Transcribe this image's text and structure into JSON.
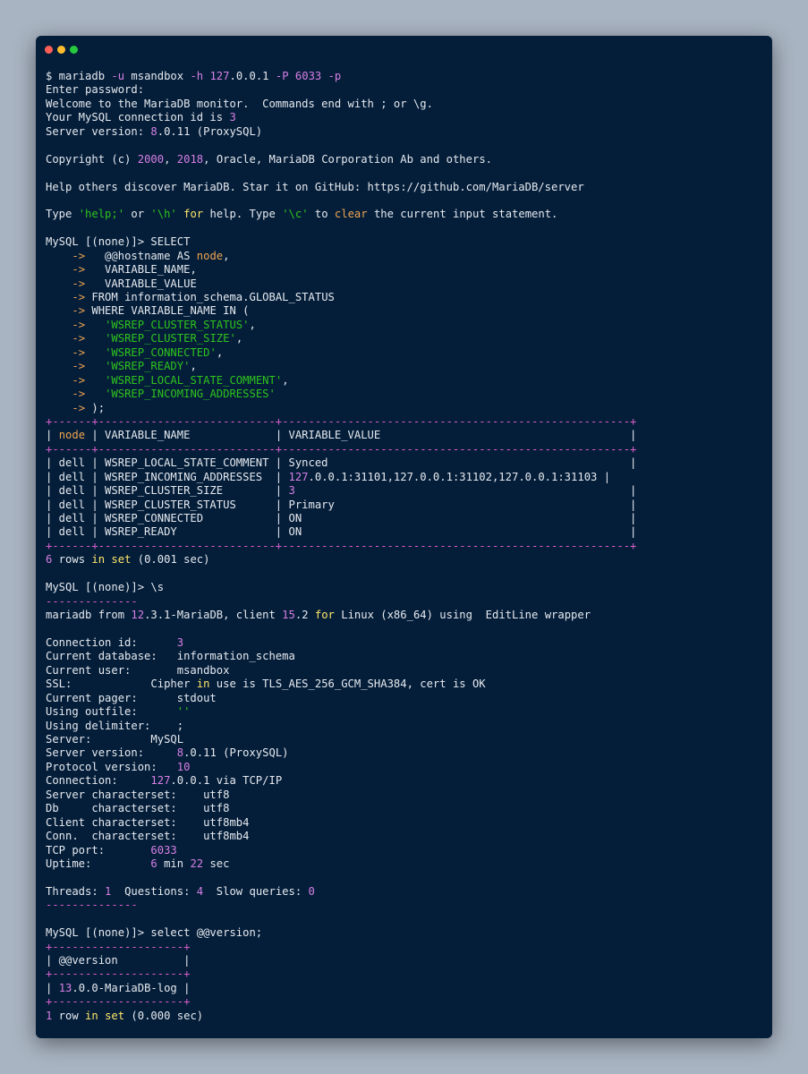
{
  "window": {
    "buttons": [
      "close",
      "minimize",
      "maximize"
    ],
    "colors": {
      "background": "#041e3a",
      "page": "#a9b4c2",
      "magenta": "#d77fe3",
      "green": "#2ec21c",
      "orange": "#f0a450",
      "yellow": "#ffe66a"
    }
  },
  "lines": [
    [
      [
        "$ mariadb ",
        ""
      ],
      [
        "-u",
        "m"
      ],
      [
        " msandbox ",
        ""
      ],
      [
        "-h",
        "m"
      ],
      [
        " ",
        ""
      ],
      [
        "127",
        "m"
      ],
      [
        ".0.0.1 ",
        ""
      ],
      [
        "-P",
        "m"
      ],
      [
        " ",
        ""
      ],
      [
        "6033",
        "m"
      ],
      [
        " ",
        ""
      ],
      [
        "-p",
        "m"
      ]
    ],
    [
      [
        "Enter password:",
        ""
      ]
    ],
    [
      [
        "Welcome to the MariaDB monitor.  Commands end with ; or \\g.",
        ""
      ]
    ],
    [
      [
        "Your MySQL connection id is ",
        ""
      ],
      [
        "3",
        "m"
      ]
    ],
    [
      [
        "Server version: ",
        ""
      ],
      [
        "8",
        "m"
      ],
      [
        ".0.11 (ProxySQL)",
        ""
      ]
    ],
    [],
    [
      [
        "Copyright (c) ",
        ""
      ],
      [
        "2000",
        "m"
      ],
      [
        ", ",
        ""
      ],
      [
        "2018",
        "m"
      ],
      [
        ", Oracle, MariaDB Corporation Ab and others.",
        ""
      ]
    ],
    [],
    [
      [
        "Help others discover MariaDB. Star it on GitHub: https://github.com/MariaDB/server",
        ""
      ]
    ],
    [],
    [
      [
        "Type ",
        ""
      ],
      [
        "'help;'",
        "g"
      ],
      [
        " or ",
        ""
      ],
      [
        "'\\h'",
        "g"
      ],
      [
        " ",
        ""
      ],
      [
        "for",
        "y"
      ],
      [
        " help. Type ",
        ""
      ],
      [
        "'\\c'",
        "g"
      ],
      [
        " to ",
        ""
      ],
      [
        "clear",
        "o"
      ],
      [
        " the current input statement.",
        ""
      ]
    ],
    [],
    [
      [
        "MySQL [(none)]> SELECT",
        ""
      ]
    ],
    [
      [
        "    ",
        ""
      ],
      [
        "->",
        "o"
      ],
      [
        "   @@hostname AS ",
        ""
      ],
      [
        "node",
        "o"
      ],
      [
        ",",
        ""
      ]
    ],
    [
      [
        "    ",
        ""
      ],
      [
        "->",
        "o"
      ],
      [
        "   VARIABLE_NAME,",
        ""
      ]
    ],
    [
      [
        "    ",
        ""
      ],
      [
        "->",
        "o"
      ],
      [
        "   VARIABLE_VALUE",
        ""
      ]
    ],
    [
      [
        "    ",
        ""
      ],
      [
        "->",
        "o"
      ],
      [
        " FROM information_schema.GLOBAL_STATUS",
        ""
      ]
    ],
    [
      [
        "    ",
        ""
      ],
      [
        "->",
        "o"
      ],
      [
        " WHERE VARIABLE_NAME IN (",
        ""
      ]
    ],
    [
      [
        "    ",
        ""
      ],
      [
        "->",
        "o"
      ],
      [
        "   ",
        ""
      ],
      [
        "'WSREP_CLUSTER_STATUS'",
        "g"
      ],
      [
        ",",
        ""
      ]
    ],
    [
      [
        "    ",
        ""
      ],
      [
        "->",
        "o"
      ],
      [
        "   ",
        ""
      ],
      [
        "'WSREP_CLUSTER_SIZE'",
        "g"
      ],
      [
        ",",
        ""
      ]
    ],
    [
      [
        "    ",
        ""
      ],
      [
        "->",
        "o"
      ],
      [
        "   ",
        ""
      ],
      [
        "'WSREP_CONNECTED'",
        "g"
      ],
      [
        ",",
        ""
      ]
    ],
    [
      [
        "    ",
        ""
      ],
      [
        "->",
        "o"
      ],
      [
        "   ",
        ""
      ],
      [
        "'WSREP_READY'",
        "g"
      ],
      [
        ",",
        ""
      ]
    ],
    [
      [
        "    ",
        ""
      ],
      [
        "->",
        "o"
      ],
      [
        "   ",
        ""
      ],
      [
        "'WSREP_LOCAL_STATE_COMMENT'",
        "g"
      ],
      [
        ",",
        ""
      ]
    ],
    [
      [
        "    ",
        ""
      ],
      [
        "->",
        "o"
      ],
      [
        "   ",
        ""
      ],
      [
        "'WSREP_INCOMING_ADDRESSES'",
        "g"
      ]
    ],
    [
      [
        "    ",
        ""
      ],
      [
        "->",
        "o"
      ],
      [
        " );",
        ""
      ]
    ],
    [
      [
        "+------+---------------------------+-----------------------------------------------------+",
        "dm"
      ]
    ],
    [
      [
        "| ",
        ""
      ],
      [
        "node",
        "o"
      ],
      [
        " | VARIABLE_NAME             | VARIABLE_VALUE                                      |",
        ""
      ]
    ],
    [
      [
        "+------+---------------------------+-----------------------------------------------------+",
        "dm"
      ]
    ],
    [
      [
        "| dell | WSREP_LOCAL_STATE_COMMENT | Synced                                              |",
        ""
      ]
    ],
    [
      [
        "| dell | WSREP_INCOMING_ADDRESSES  | ",
        ""
      ],
      [
        "127",
        "m"
      ],
      [
        ".0.0.1:31101,127.0.0.1:31102,127.0.0.1:31103 |",
        ""
      ]
    ],
    [
      [
        "| dell | WSREP_CLUSTER_SIZE        | ",
        ""
      ],
      [
        "3",
        "m"
      ],
      [
        "                                                   |",
        ""
      ]
    ],
    [
      [
        "| dell | WSREP_CLUSTER_STATUS      | Primary                                             |",
        ""
      ]
    ],
    [
      [
        "| dell | WSREP_CONNECTED           | ON                                                  |",
        ""
      ]
    ],
    [
      [
        "| dell | WSREP_READY               | ON                                                  |",
        ""
      ]
    ],
    [
      [
        "+------+---------------------------+-----------------------------------------------------+",
        "dm"
      ]
    ],
    [
      [
        "6",
        "m"
      ],
      [
        " rows ",
        ""
      ],
      [
        "in",
        "y"
      ],
      [
        " ",
        ""
      ],
      [
        "set",
        "y"
      ],
      [
        " (0.001 sec)",
        ""
      ]
    ],
    [],
    [
      [
        "MySQL [(none)]> \\s",
        ""
      ]
    ],
    [
      [
        "--------------",
        "dm"
      ]
    ],
    [
      [
        "mariadb from ",
        ""
      ],
      [
        "12",
        "m"
      ],
      [
        ".3.1-MariaDB, client ",
        ""
      ],
      [
        "15",
        "m"
      ],
      [
        ".2 ",
        ""
      ],
      [
        "for",
        "y"
      ],
      [
        " Linux (x86_64) using  EditLine wrapper",
        ""
      ]
    ],
    [],
    [
      [
        "Connection id:      ",
        ""
      ],
      [
        "3",
        "m"
      ]
    ],
    [
      [
        "Current database:   information_schema",
        ""
      ]
    ],
    [
      [
        "Current user:       msandbox",
        ""
      ]
    ],
    [
      [
        "SSL:            Cipher ",
        ""
      ],
      [
        "in",
        "y"
      ],
      [
        " use is TLS_AES_256_GCM_SHA384, cert is OK",
        ""
      ]
    ],
    [
      [
        "Current pager:      stdout",
        ""
      ]
    ],
    [
      [
        "Using outfile:      ",
        ""
      ],
      [
        "''",
        "g"
      ]
    ],
    [
      [
        "Using delimiter:    ;",
        ""
      ]
    ],
    [
      [
        "Server:         MySQL",
        ""
      ]
    ],
    [
      [
        "Server version:     ",
        ""
      ],
      [
        "8",
        "m"
      ],
      [
        ".0.11 (ProxySQL)",
        ""
      ]
    ],
    [
      [
        "Protocol version:   ",
        ""
      ],
      [
        "10",
        "m"
      ]
    ],
    [
      [
        "Connection:     ",
        ""
      ],
      [
        "127",
        "m"
      ],
      [
        ".0.0.1 via TCP/IP",
        ""
      ]
    ],
    [
      [
        "Server characterset:    utf8",
        ""
      ]
    ],
    [
      [
        "Db     characterset:    utf8",
        ""
      ]
    ],
    [
      [
        "Client characterset:    utf8mb4",
        ""
      ]
    ],
    [
      [
        "Conn.  characterset:    utf8mb4",
        ""
      ]
    ],
    [
      [
        "TCP port:       ",
        ""
      ],
      [
        "6033",
        "m"
      ]
    ],
    [
      [
        "Uptime:         ",
        ""
      ],
      [
        "6",
        "m"
      ],
      [
        " min ",
        ""
      ],
      [
        "22",
        "m"
      ],
      [
        " sec",
        ""
      ]
    ],
    [],
    [
      [
        "Threads: ",
        ""
      ],
      [
        "1",
        "m"
      ],
      [
        "  Questions: ",
        ""
      ],
      [
        "4",
        "m"
      ],
      [
        "  Slow queries: ",
        ""
      ],
      [
        "0",
        "m"
      ]
    ],
    [
      [
        "--------------",
        "dm"
      ]
    ],
    [],
    [
      [
        "MySQL [(none)]> select @@version;",
        ""
      ]
    ],
    [
      [
        "+--------------------+",
        "dm"
      ]
    ],
    [
      [
        "| @@version          |",
        ""
      ]
    ],
    [
      [
        "+--------------------+",
        "dm"
      ]
    ],
    [
      [
        "| ",
        ""
      ],
      [
        "13",
        "m"
      ],
      [
        ".0.0-MariaDB-log |",
        ""
      ]
    ],
    [
      [
        "+--------------------+",
        "dm"
      ]
    ],
    [
      [
        "1",
        "m"
      ],
      [
        " row ",
        ""
      ],
      [
        "in",
        "y"
      ],
      [
        " ",
        ""
      ],
      [
        "set",
        "y"
      ],
      [
        " (0.000 sec)",
        ""
      ]
    ]
  ]
}
